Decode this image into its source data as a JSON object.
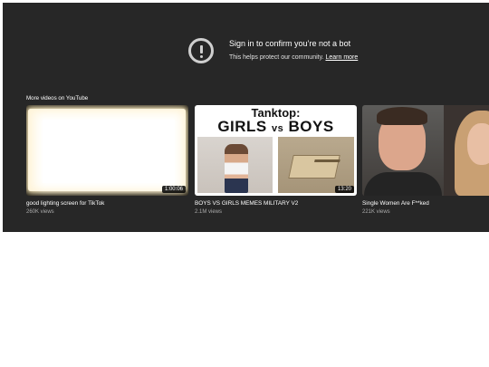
{
  "signin": {
    "title": "Sign in to confirm you’re not a bot",
    "subtitle": "This helps protect our community. ",
    "link": "Learn more",
    "icon": "alert-circle-icon"
  },
  "more_videos": {
    "title": "More videos on YouTube",
    "videos": [
      {
        "title": "good lighting screen for TikTok",
        "views": "260K views",
        "duration": "1:00:06"
      },
      {
        "title": "BOYS VS GIRLS MEMES MILITARY V2",
        "views": "2.1M views",
        "duration": "13:20",
        "thumb_text": {
          "top": "Tanktop:",
          "left": "GIRLS",
          "vs": "vs",
          "right": "BOYS"
        }
      },
      {
        "title": "Single Women Are F**ked",
        "views": "221K views"
      }
    ]
  },
  "colors": {
    "player_bg": "#272727",
    "text": "#ffffff",
    "meta_text": "#aaaaaa"
  }
}
